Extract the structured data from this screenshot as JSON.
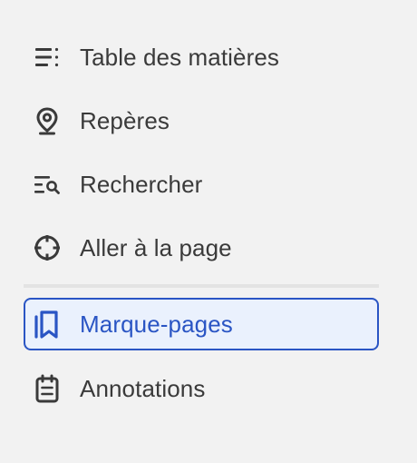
{
  "menu": {
    "items": [
      {
        "label": "Table des matières",
        "icon": "list-icon"
      },
      {
        "label": "Repères",
        "icon": "location-pin-icon"
      },
      {
        "label": "Rechercher",
        "icon": "search-list-icon"
      },
      {
        "label": "Aller à la page",
        "icon": "crosshair-icon"
      },
      {
        "label": "Marque-pages",
        "icon": "bookmarks-icon",
        "selected": true
      },
      {
        "label": "Annotations",
        "icon": "notepad-icon"
      }
    ]
  },
  "colors": {
    "background": "#f2f2f2",
    "text": "#3a3a3a",
    "accent": "#2a55c4",
    "selected_background": "#eaf1fd",
    "divider": "#e3e3e3"
  }
}
